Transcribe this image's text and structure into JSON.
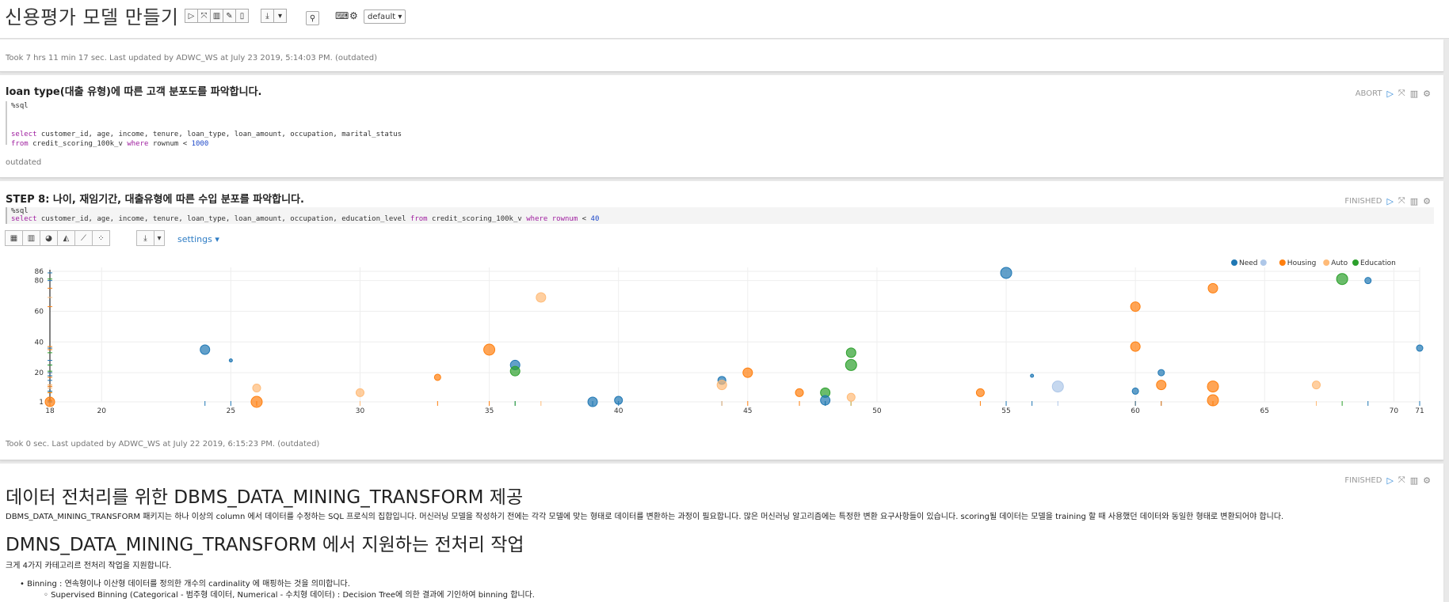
{
  "notebook": {
    "title": "신용평가 모델 만들기",
    "interpreter": "default ▾"
  },
  "paragraph1": {
    "footer": "Took 7 hrs 11 min 17 sec. Last updated by ADWC_WS at July 23 2019, 5:14:03 PM. (outdated)"
  },
  "paragraph2": {
    "title": "loan type(대출 유형)에 따른 고객 분포도를 파악합니다.",
    "status": "ABORT",
    "code_line1": "%sql",
    "code_kw1": "select",
    "code_rest1": " customer_id, age, income, tenure, loan_type, loan_amount, occupation, marital_status",
    "code_kw2": "from",
    "code_rest2a": " credit_scoring_100k_v ",
    "code_kw3": "where",
    "code_rest2b": " rownum < ",
    "code_num": "1000",
    "footer": "outdated"
  },
  "paragraph3": {
    "title": "STEP 8: 나이, 재임기간, 대출유형에 따른 수입 분포를 파악합니다.",
    "status": "FINISHED",
    "code_line1": "%sql",
    "code_kw1": "select",
    "code_rest1": " customer_id, age, income, tenure, loan_type, loan_amount, occupation, education_level ",
    "code_kw2": "from",
    "code_rest2": " credit_scoring_100k_v ",
    "code_kw3": "where",
    "code_kw4": "rownum",
    "code_rest3": " < ",
    "code_num": "40",
    "settings": "settings ▾",
    "footer": "Took 0 sec. Last updated by ADWC_WS at July 22 2019, 6:15:23 PM. (outdated)"
  },
  "paragraph4": {
    "status": "FINISHED",
    "h1a": "데이터 전처리를 위한 DBMS_DATA_MINING_TRANSFORM 제공",
    "p1": "DBMS_DATA_MINING_TRANSFORM 패키지는 하나 이상의 column 에서 데이터를 수정하는 SQL 프로식의 집합입니다. 머신러닝 모델을 작성하기 전에는 각각 모델에 맞는 형태로 데이터를 변환하는 과정이 필요합니다. 많은 머신러닝 알고리즘에는 특정한 변환 요구사항들이 있습니다. scoring될 데이터는 모델을 training 할 때 사용했던 데이터와 동일한 형태로 변환되어야 합니다.",
    "h1b": "DMNS_DATA_MINING_TRANSFORM 에서 지원하는 전처리 작업",
    "p2": "크게 4가지 카테고리르 전처리 작업을 지원합니다.",
    "li1": "Binning : 연속형이나 이산형 데이터를 정의한 개수의 cardinality 에 매핑하는 것을 의미합니다.",
    "li2": "Supervised Binning (Categorical - 범주형 데이터, Numerical - 수치형 데이터) : Decision Tree에 의한 결과에 기인하여 binning 합니다."
  },
  "chart_data": {
    "type": "scatter",
    "x_ticks": [
      18,
      20,
      25,
      30,
      35,
      40,
      45,
      50,
      55,
      60,
      65,
      70,
      71
    ],
    "y_ticks": [
      1,
      20,
      40,
      60,
      80,
      86
    ],
    "xlim": [
      18,
      71
    ],
    "ylim": [
      1,
      86
    ],
    "legend_position": "top-right",
    "grid": true,
    "legend": [
      {
        "name": "Need",
        "color": "#1f77b4"
      },
      {
        "name": "",
        "color": "#aec7e8"
      },
      {
        "name": "Housing",
        "color": "#ff7f0e"
      },
      {
        "name": "Auto",
        "color": "#ffbb78"
      },
      {
        "name": "Education",
        "color": "#2ca02c"
      }
    ],
    "points": [
      {
        "x": 18,
        "y": 1,
        "size": 6,
        "color": "#ff7f0e"
      },
      {
        "x": 24,
        "y": 35,
        "size": 6,
        "color": "#1f77b4"
      },
      {
        "x": 25,
        "y": 28,
        "size": 2,
        "color": "#1f77b4"
      },
      {
        "x": 26,
        "y": 10,
        "size": 5,
        "color": "#ffbb78"
      },
      {
        "x": 26,
        "y": 1,
        "size": 7,
        "color": "#ff7f0e"
      },
      {
        "x": 30,
        "y": 7,
        "size": 5,
        "color": "#ffbb78"
      },
      {
        "x": 33,
        "y": 17,
        "size": 4,
        "color": "#ff7f0e"
      },
      {
        "x": 35,
        "y": 35,
        "size": 7,
        "color": "#ff7f0e"
      },
      {
        "x": 36,
        "y": 25,
        "size": 6,
        "color": "#1f77b4"
      },
      {
        "x": 36,
        "y": 21,
        "size": 6,
        "color": "#2ca02c"
      },
      {
        "x": 37,
        "y": 69,
        "size": 6,
        "color": "#ffbb78"
      },
      {
        "x": 39,
        "y": 1,
        "size": 6,
        "color": "#1f77b4"
      },
      {
        "x": 40,
        "y": 2,
        "size": 5,
        "color": "#1f77b4"
      },
      {
        "x": 44,
        "y": 15,
        "size": 5,
        "color": "#1f77b4"
      },
      {
        "x": 44,
        "y": 12,
        "size": 6,
        "color": "#ffbb78"
      },
      {
        "x": 45,
        "y": 20,
        "size": 6,
        "color": "#ff7f0e"
      },
      {
        "x": 47,
        "y": 7,
        "size": 5,
        "color": "#ff7f0e"
      },
      {
        "x": 48,
        "y": 7,
        "size": 6,
        "color": "#2ca02c"
      },
      {
        "x": 48,
        "y": 2,
        "size": 6,
        "color": "#1f77b4"
      },
      {
        "x": 49,
        "y": 33,
        "size": 6,
        "color": "#2ca02c"
      },
      {
        "x": 49,
        "y": 25,
        "size": 7,
        "color": "#2ca02c"
      },
      {
        "x": 49,
        "y": 4,
        "size": 5,
        "color": "#ffbb78"
      },
      {
        "x": 54,
        "y": 7,
        "size": 5,
        "color": "#ff7f0e"
      },
      {
        "x": 55,
        "y": 85,
        "size": 7,
        "color": "#1f77b4"
      },
      {
        "x": 56,
        "y": 18,
        "size": 2,
        "color": "#1f77b4"
      },
      {
        "x": 57,
        "y": 11,
        "size": 7,
        "color": "#aec7e8"
      },
      {
        "x": 60,
        "y": 63,
        "size": 6,
        "color": "#ff7f0e"
      },
      {
        "x": 60,
        "y": 37,
        "size": 6,
        "color": "#ff7f0e"
      },
      {
        "x": 60,
        "y": 8,
        "size": 4,
        "color": "#1f77b4"
      },
      {
        "x": 61,
        "y": 20,
        "size": 4,
        "color": "#1f77b4"
      },
      {
        "x": 61,
        "y": 12,
        "size": 6,
        "color": "#ff7f0e"
      },
      {
        "x": 63,
        "y": 75,
        "size": 6,
        "color": "#ff7f0e"
      },
      {
        "x": 63,
        "y": 11,
        "size": 7,
        "color": "#ff7f0e"
      },
      {
        "x": 63,
        "y": 2,
        "size": 7,
        "color": "#ff7f0e"
      },
      {
        "x": 67,
        "y": 12,
        "size": 5,
        "color": "#ffbb78"
      },
      {
        "x": 68,
        "y": 81,
        "size": 7,
        "color": "#2ca02c"
      },
      {
        "x": 69,
        "y": 80,
        "size": 4,
        "color": "#1f77b4"
      },
      {
        "x": 71,
        "y": 36,
        "size": 4,
        "color": "#1f77b4"
      }
    ]
  }
}
